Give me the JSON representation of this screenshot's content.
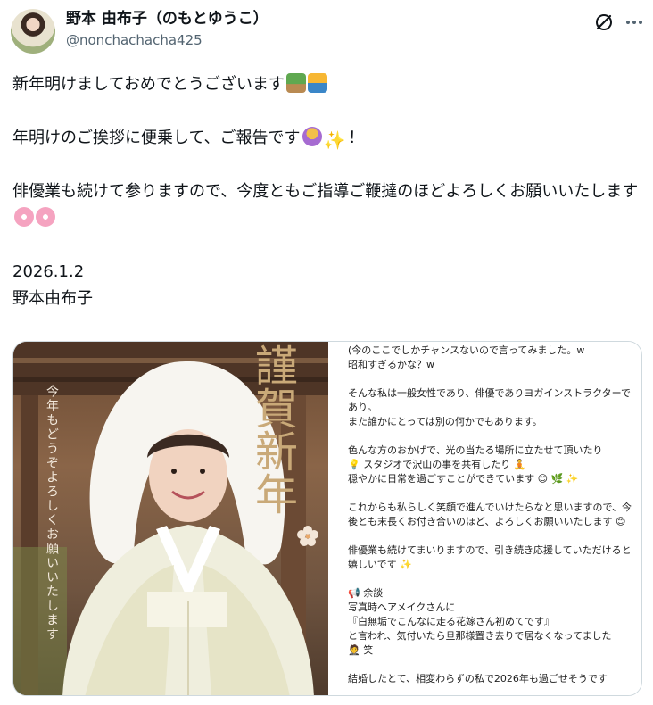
{
  "user": {
    "display_name": "野本 由布子（のもとゆうこ）",
    "handle": "@nonchachacha425"
  },
  "icons": {
    "avatar": "profile-photo",
    "grok": "grok-slash-circle-icon",
    "more": "more-dots-icon"
  },
  "tweet": {
    "line1": "新年明けましておめでとうございます",
    "line2_a": "年明けのご挨拶に便乗して、ご報告です",
    "line2_b": "！",
    "line3": "俳優業も続けて参りますので、今度ともご指導ご鞭撻のほどよろしくお願いいたします",
    "date": "2026.1.2",
    "signature": "野本由布子"
  },
  "image": {
    "title_chars": "謹賀新年",
    "vertical_text": "今年もどうぞよろしくお願いいたします"
  },
  "note": {
    "p1a": "(今のここでしかチャンスないので言ってみました。w",
    "p1b": "昭和すぎるかな？w",
    "p2a": "そんな私は一般女性であり、俳優でありヨガインストラクターであり。",
    "p2b": "また誰かにとっては別の何かでもあります。",
    "p3a": "色んな方のおかげで、光の当たる場所に立たせて頂いたり",
    "p3b": "スタジオで沢山の事を共有したり",
    "p3c": "穏やかに日常を過ごすことができています",
    "p4": "これからも私らしく笑顔で進んでいけたらなと思いますので、今後とも末長くお付き合いのほど、よろしくお願いいたします",
    "p5": "俳優業も続けてまいりますので、引き続き応援していただけると嬉しいです",
    "p6a": "余談",
    "p6b": "写真時ヘアメイクさんに",
    "p6c": "『白無垢でこんなに走る花嫁さん初めてです』",
    "p6d": "と言われ、気付いたら旦那様置き去りで居なくなってました",
    "p6e": "笑",
    "p7": "結婚したとて、相変わらずの私で2026年も過ごせそうです"
  },
  "colors": {
    "text": "#0f1419",
    "muted": "#536471",
    "border": "#cfd9de",
    "gold": "#c9a978"
  }
}
